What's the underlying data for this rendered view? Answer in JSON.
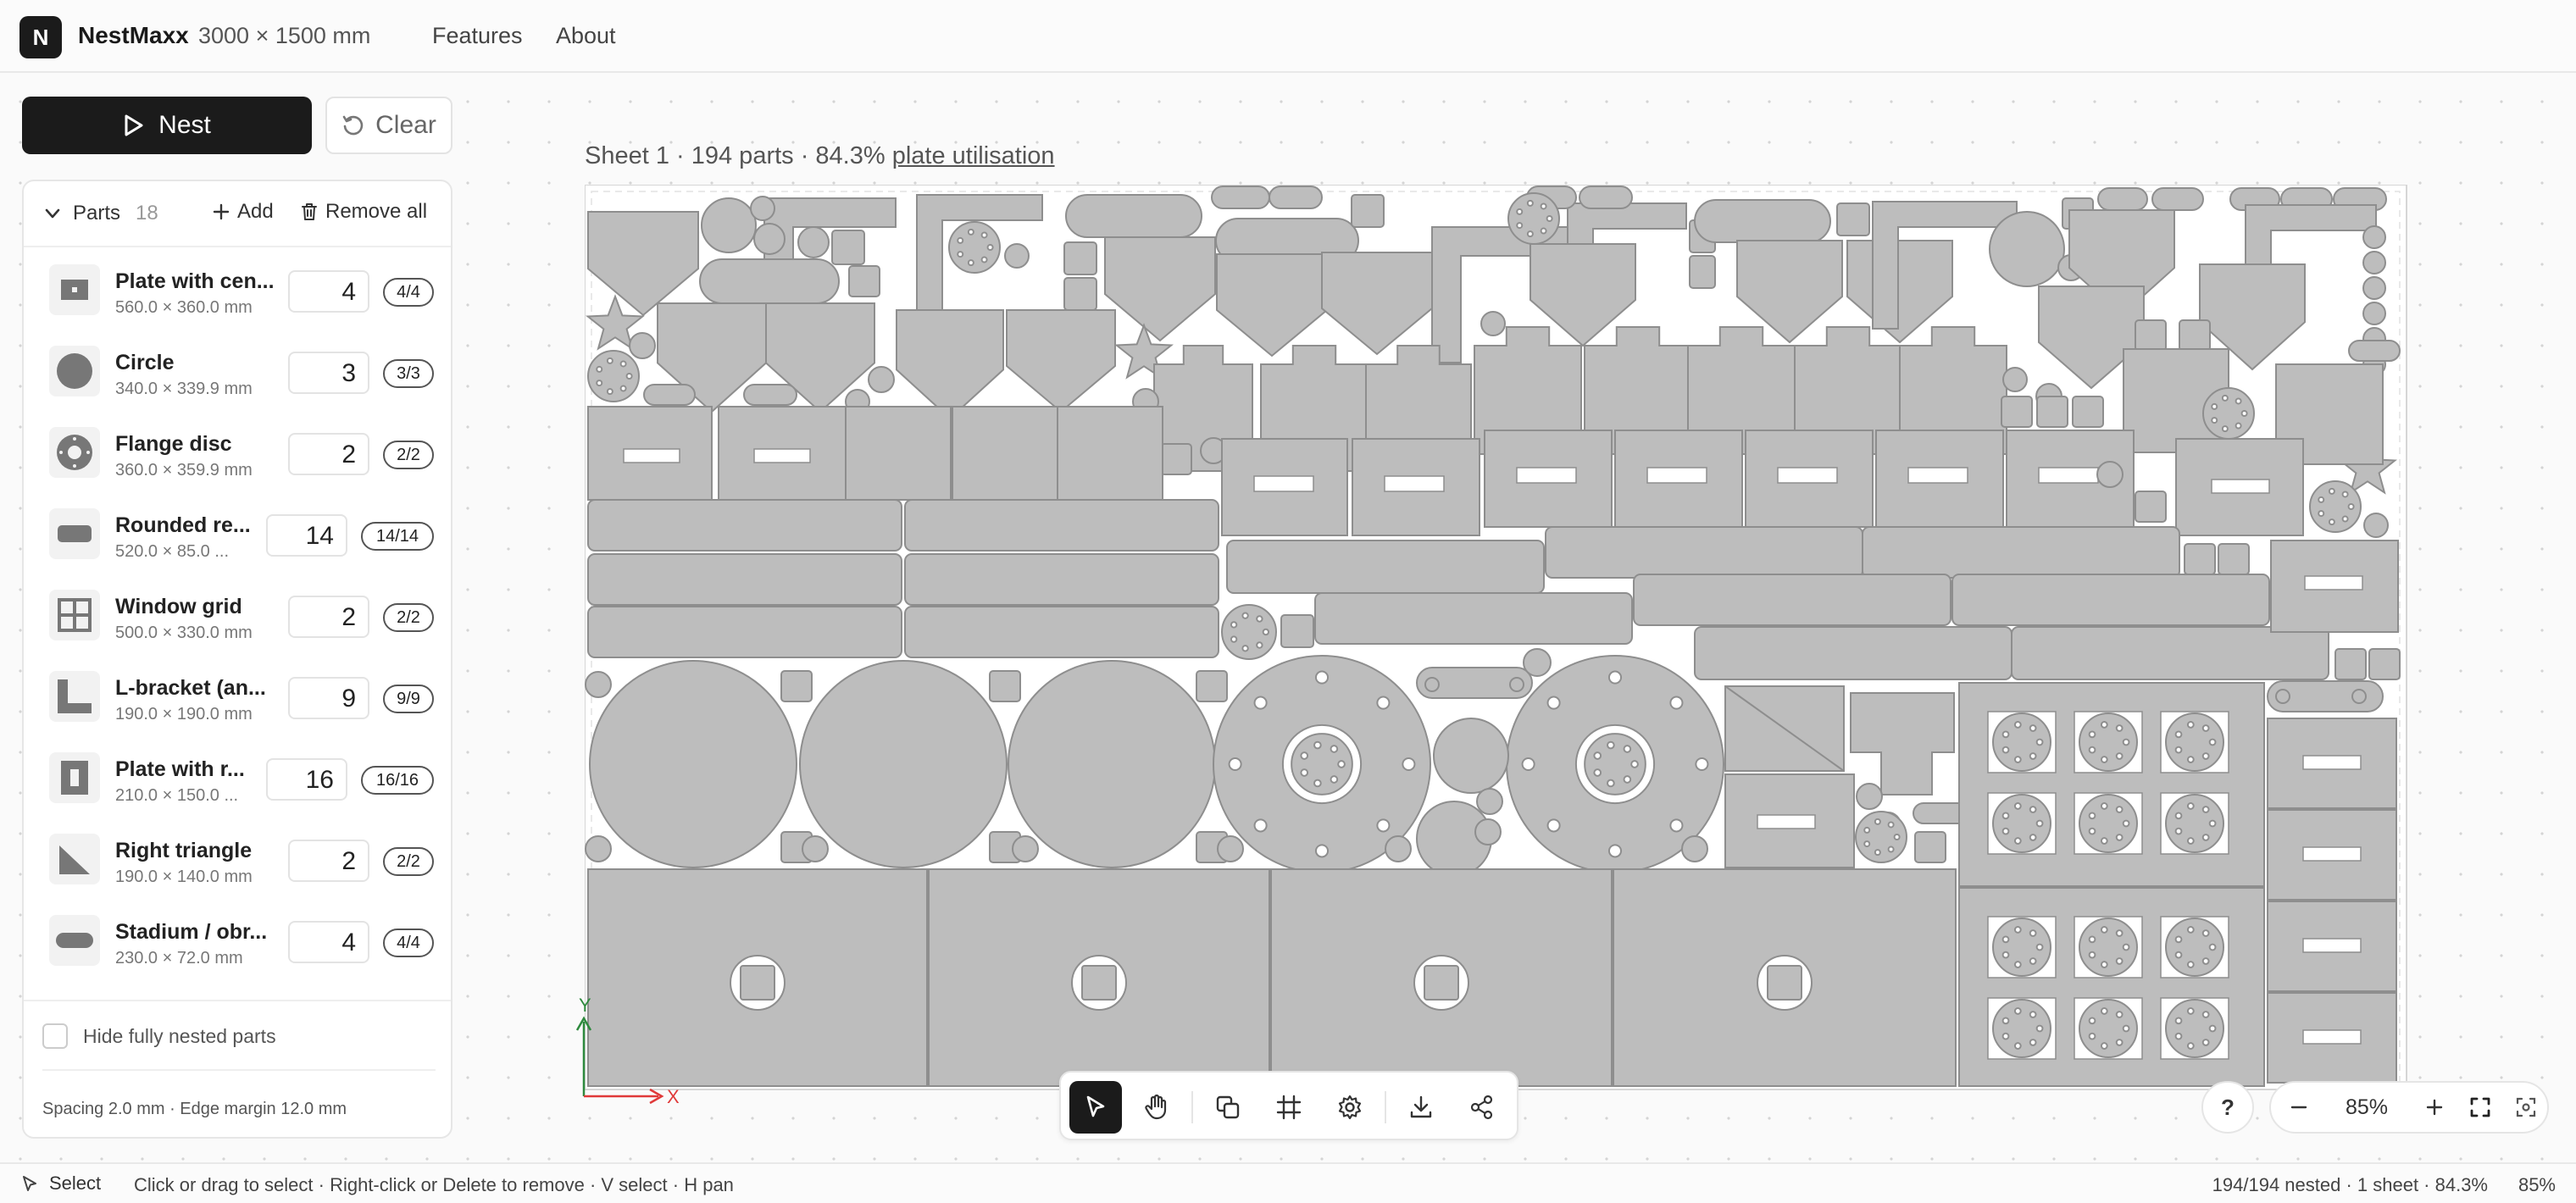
{
  "app": {
    "logo_letter": "N",
    "name": "NestMaxx",
    "sheet_size": "3000 × 1500 mm"
  },
  "nav": {
    "features": "Features",
    "about": "About"
  },
  "actions": {
    "nest_label": "Nest",
    "clear_label": "Clear"
  },
  "parts_panel": {
    "title": "Parts",
    "count": "18",
    "add_label": "Add",
    "remove_all_label": "Remove all",
    "items": [
      {
        "name": "Plate with cen...",
        "dims": "560.0 × 360.0 mm",
        "qty": "4",
        "nested": "4/4",
        "icon": "plate-center-hole-icon"
      },
      {
        "name": "Circle",
        "dims": "340.0 × 339.9 mm",
        "qty": "3",
        "nested": "3/3",
        "icon": "circle-icon"
      },
      {
        "name": "Flange disc",
        "dims": "360.0 × 359.9 mm",
        "qty": "2",
        "nested": "2/2",
        "icon": "flange-disc-icon"
      },
      {
        "name": "Rounded re...",
        "dims": "520.0 × 85.0 ...",
        "qty": "14",
        "nested": "14/14",
        "icon": "rounded-rect-icon"
      },
      {
        "name": "Window grid",
        "dims": "500.0 × 330.0 mm",
        "qty": "2",
        "nested": "2/2",
        "icon": "window-grid-icon"
      },
      {
        "name": "L-bracket (an...",
        "dims": "190.0 × 190.0 mm",
        "qty": "9",
        "nested": "9/9",
        "icon": "l-bracket-icon"
      },
      {
        "name": "Plate with r...",
        "dims": "210.0 × 150.0 ...",
        "qty": "16",
        "nested": "16/16",
        "icon": "plate-rect-hole-icon"
      },
      {
        "name": "Right triangle",
        "dims": "190.0 × 140.0 mm",
        "qty": "2",
        "nested": "2/2",
        "icon": "right-triangle-icon"
      },
      {
        "name": "Stadium / obr...",
        "dims": "230.0 × 72.0 mm",
        "qty": "4",
        "nested": "4/4",
        "icon": "stadium-icon"
      }
    ],
    "hide_nested_label": "Hide fully nested parts",
    "spacing_text": "Spacing 2.0 mm · Edge margin 12.0 mm"
  },
  "sheet": {
    "prefix": "Sheet 1 · 194 parts · 84.3%",
    "link": "plate utilisation"
  },
  "axes": {
    "y": "Y",
    "x": "X"
  },
  "toolbar": {
    "select": "select-arrow-icon",
    "pan": "hand-icon",
    "clone": "clone-icon",
    "grid": "grid-icon",
    "settings": "gear-icon",
    "download": "download-icon",
    "share": "share-icon"
  },
  "zoom": {
    "help": "?",
    "level": "85%"
  },
  "status": {
    "mode": "Select",
    "hint": "Click or drag to select · Right-click or Delete to remove · V select · H pan",
    "stats": "194/194 nested · 1 sheet · 84.3%",
    "zoom": "85%"
  },
  "colors": {
    "accent": "#1b1b1b",
    "part_fill": "#bdbdbd",
    "part_stroke": "#8e8e8e",
    "x_axis": "#e03a3a",
    "y_axis": "#2e8a3e"
  }
}
